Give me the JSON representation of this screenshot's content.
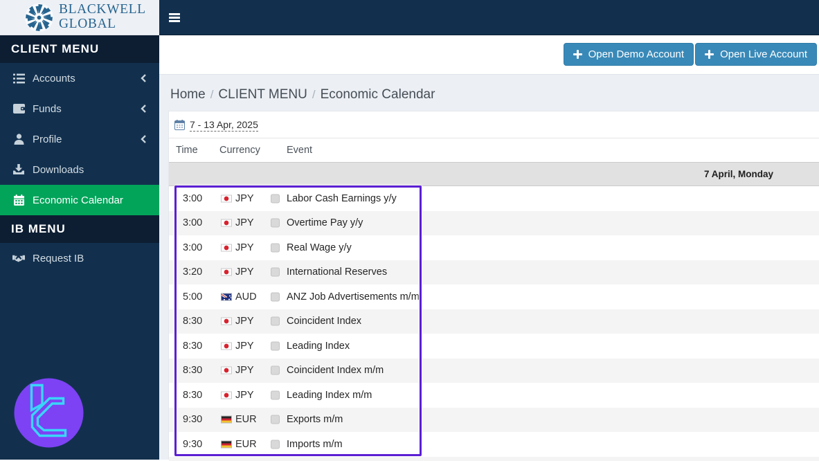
{
  "brand": {
    "name_line1": "BLACKWELL",
    "name_line2": "GLOBAL"
  },
  "sidebar": {
    "client_menu_header": "CLIENT MENU",
    "ib_menu_header": "IB MENU",
    "items": [
      {
        "label": "Accounts",
        "icon": "list",
        "expandable": true
      },
      {
        "label": "Funds",
        "icon": "wallet",
        "expandable": true
      },
      {
        "label": "Profile",
        "icon": "user",
        "expandable": true
      },
      {
        "label": "Downloads",
        "icon": "download",
        "expandable": false
      },
      {
        "label": "Economic Calendar",
        "icon": "calendar",
        "active": true
      }
    ],
    "ib_items": [
      {
        "label": "Request IB",
        "icon": "handshake"
      }
    ]
  },
  "header_actions": {
    "open_demo": "Open Demo Account",
    "open_live": "Open Live Account"
  },
  "breadcrumb": {
    "home": "Home",
    "section": "CLIENT MENU",
    "page": "Economic Calendar"
  },
  "calendar": {
    "date_range": "7 - 13 Apr, 2025",
    "columns": {
      "time": "Time",
      "currency": "Currency",
      "event": "Event"
    },
    "day_header": "7 April, Monday",
    "rows": [
      {
        "time": "3:00",
        "currency": "JPY",
        "flag": "jp",
        "event": "Labor Cash Earnings y/y"
      },
      {
        "time": "3:00",
        "currency": "JPY",
        "flag": "jp",
        "event": "Overtime Pay y/y"
      },
      {
        "time": "3:00",
        "currency": "JPY",
        "flag": "jp",
        "event": "Real Wage y/y"
      },
      {
        "time": "3:20",
        "currency": "JPY",
        "flag": "jp",
        "event": "International Reserves"
      },
      {
        "time": "5:00",
        "currency": "AUD",
        "flag": "au",
        "event": "ANZ Job Advertisements m/m"
      },
      {
        "time": "8:30",
        "currency": "JPY",
        "flag": "jp",
        "event": "Coincident Index"
      },
      {
        "time": "8:30",
        "currency": "JPY",
        "flag": "jp",
        "event": "Leading Index"
      },
      {
        "time": "8:30",
        "currency": "JPY",
        "flag": "jp",
        "event": "Coincident Index m/m"
      },
      {
        "time": "8:30",
        "currency": "JPY",
        "flag": "jp",
        "event": "Leading Index m/m"
      },
      {
        "time": "9:30",
        "currency": "EUR",
        "flag": "de",
        "event": "Exports m/m"
      },
      {
        "time": "9:30",
        "currency": "EUR",
        "flag": "de",
        "event": "Imports m/m"
      }
    ]
  },
  "colors": {
    "navy": "#12304e",
    "menu_header_bg": "#0d1e33",
    "active_green": "#02a45a",
    "button_blue": "#3989b8",
    "brand_blue": "#27648f",
    "content_bg": "#ecf0f5",
    "annotation_purple": "#5b1fd3",
    "watermark_purple": "#7d42f4",
    "watermark_cyan": "#39d6f8"
  }
}
